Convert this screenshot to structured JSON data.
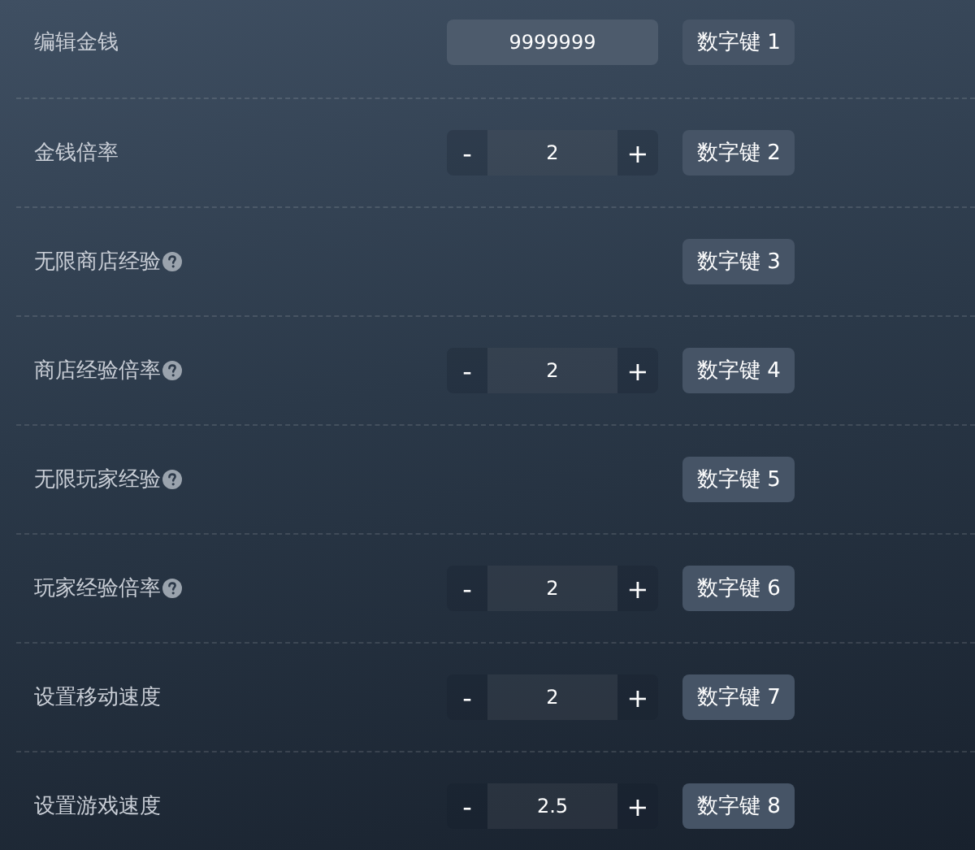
{
  "settings": [
    {
      "label": "编辑金钱",
      "help": false,
      "kind": "input",
      "value": "9999999",
      "hotkey": "数字键 1"
    },
    {
      "label": "金钱倍率",
      "help": false,
      "kind": "stepper",
      "minus": "-",
      "value": "2",
      "plus": "+",
      "hotkey": "数字键 2"
    },
    {
      "label": "无限商店经验",
      "help": true,
      "kind": "none",
      "hotkey": "数字键 3"
    },
    {
      "label": "商店经验倍率",
      "help": true,
      "kind": "stepper",
      "minus": "-",
      "value": "2",
      "plus": "+",
      "hotkey": "数字键 4"
    },
    {
      "label": "无限玩家经验",
      "help": true,
      "kind": "none",
      "hotkey": "数字键 5"
    },
    {
      "label": "玩家经验倍率",
      "help": true,
      "kind": "stepper",
      "minus": "-",
      "value": "2",
      "plus": "+",
      "hotkey": "数字键 6"
    },
    {
      "label": "设置移动速度",
      "help": false,
      "kind": "stepper",
      "minus": "-",
      "value": "2",
      "plus": "+",
      "hotkey": "数字键 7"
    },
    {
      "label": "设置游戏速度",
      "help": false,
      "kind": "stepper",
      "minus": "-",
      "value": "2.5",
      "plus": "+",
      "hotkey": "数字键 8"
    }
  ]
}
